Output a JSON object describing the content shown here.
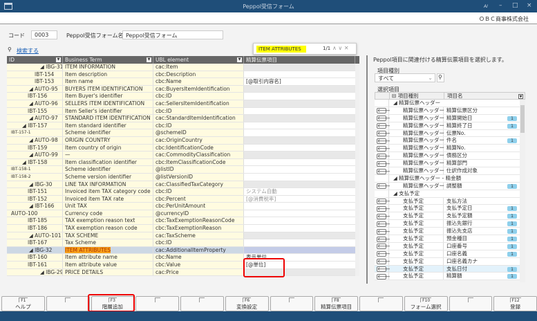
{
  "window": {
    "title": "Peppol受信フォーム",
    "company": "ＯＢＣ商事株式会社",
    "ai_label": "AI"
  },
  "form": {
    "code_label": "コード",
    "code_value": "0003",
    "name_label": "Peppol受信フォーム名",
    "name_value": "Peppol受信フォーム",
    "search_link": "検索する"
  },
  "find": {
    "query": "ITEM ATTRIBUTES",
    "count": "1/1"
  },
  "grid": {
    "headers": [
      "ID",
      "Business Term",
      "UBL element",
      "精算伝票項目"
    ],
    "rows": [
      {
        "id": "IBG-31",
        "term": "ITEM INFORMATION",
        "ubl": "cac:Item",
        "map": "",
        "group": true,
        "lvl": 0
      },
      {
        "id": "IBT-154",
        "term": "Item description",
        "ubl": "cbc:Description",
        "map": "",
        "lvl": 1
      },
      {
        "id": "IBT-153",
        "term": "Item name",
        "ubl": "cbc:Name",
        "map": "[@取引内容名]",
        "lvl": 1
      },
      {
        "id": "AUTO-95",
        "term": "BUYERS ITEM IDENTIFICATION",
        "ubl": "cac:BuyersItemIdentification",
        "map": "",
        "group": true,
        "lvl": 1
      },
      {
        "id": "IBT-156",
        "term": "Item Buyer's identifier",
        "ubl": "cbc:ID",
        "map": "",
        "lvl": 2
      },
      {
        "id": "AUTO-96",
        "term": "SELLERS ITEM IDENTIFICATION",
        "ubl": "cac:SellersItemIdentification",
        "map": "",
        "group": true,
        "lvl": 1
      },
      {
        "id": "IBT-155",
        "term": "Item Seller's identifier",
        "ubl": "cbc:ID",
        "map": "",
        "lvl": 2
      },
      {
        "id": "AUTO-97",
        "term": "STANDARD ITEM IDENTIFICATION",
        "ubl": "cac:StandardItemIdentification",
        "map": "",
        "group": true,
        "lvl": 1
      },
      {
        "id": "IBT-157",
        "term": "Item standard identifier",
        "ubl": "cbc:ID",
        "map": "",
        "lvl": 2,
        "exp": true
      },
      {
        "id": "IBT-157-1",
        "term": "Scheme identifier",
        "ubl": "@schemeID",
        "map": "",
        "lvl": 3
      },
      {
        "id": "AUTO-98",
        "term": "ORIGIN COUNTRY",
        "ubl": "cac:OriginCountry",
        "map": "",
        "group": true,
        "lvl": 1
      },
      {
        "id": "IBT-159",
        "term": "Item country of origin",
        "ubl": "cbc:IdentificationCode",
        "map": "",
        "lvl": 2
      },
      {
        "id": "AUTO-99",
        "term": "—",
        "ubl": "cac:CommodityClassification",
        "map": "",
        "group": true,
        "lvl": 1
      },
      {
        "id": "IBT-158",
        "term": "Item classification identifier",
        "ubl": "cbc:ItemClassificationCode",
        "map": "",
        "lvl": 2,
        "exp": true
      },
      {
        "id": "IBT-158-1",
        "term": "Scheme identifier",
        "ubl": "@listID",
        "map": "",
        "lvl": 3
      },
      {
        "id": "IBT-158-2",
        "term": "Scheme version identifier",
        "ubl": "@listVersionID",
        "map": "",
        "lvl": 3
      },
      {
        "id": "IBG-30",
        "term": "LINE TAX INFORMATION",
        "ubl": "cac:ClassifiedTaxCategory",
        "map": "",
        "group": true,
        "lvl": 1
      },
      {
        "id": "IBT-151",
        "term": "Invoiced item TAX category code",
        "ubl": "cbc:ID",
        "map": "システム自動",
        "lvl": 2,
        "gray": true
      },
      {
        "id": "IBT-152",
        "term": "Invoiced item TAX rate",
        "ubl": "cbc:Percent",
        "map": "[@消費税率]",
        "lvl": 2,
        "gray": true
      },
      {
        "id": "IBT-166",
        "term": "Unit TAX",
        "ubl": "cbc:PerUnitAmount",
        "map": "",
        "lvl": 1,
        "exp": true
      },
      {
        "id": "AUTO-100",
        "term": "Currency code",
        "ubl": "@currencyID",
        "map": "",
        "lvl": 3
      },
      {
        "id": "IBT-185",
        "term": "TAX exemption reason text",
        "ubl": "cbc:TaxExemptionReasonCode",
        "map": "",
        "lvl": 2
      },
      {
        "id": "IBT-186",
        "term": "TAX exemption reason code",
        "ubl": "cbc:TaxExemptionReason",
        "map": "",
        "lvl": 2
      },
      {
        "id": "AUTO-101",
        "term": "TAX SCHEME",
        "ubl": "cac:TaxScheme",
        "map": "",
        "group": true,
        "lvl": 1
      },
      {
        "id": "IBT-167",
        "term": "Tax Scheme",
        "ubl": "cbc:ID",
        "map": "",
        "lvl": 2
      },
      {
        "id": "IBG-32",
        "term": "ITEM ATTRIBUTES",
        "ubl": "cac:AdditionalItemProperty",
        "map": "",
        "group": true,
        "lvl": 1,
        "selected": true
      },
      {
        "id": "IBT-160",
        "term": "Item attribute name",
        "ubl": "cbc:Name",
        "map": "表示単位",
        "lvl": 2
      },
      {
        "id": "IBT-161",
        "term": "Item attribute value",
        "ubl": "cbc:Value",
        "map": "[@単位]",
        "lvl": 2
      },
      {
        "id": "IBG-29",
        "term": "PRICE DETAILS",
        "ubl": "cac:Price",
        "map": "",
        "group": true,
        "lvl": 0
      }
    ]
  },
  "right": {
    "description": "Peppol項目に関連付ける精算伝票項目を選択します。",
    "type_label": "項目種別",
    "type_value": "すべて",
    "list_label": "選択項目",
    "headers": [
      "項目種別",
      "項目名"
    ],
    "rows": [
      {
        "group": "精算伝票ヘッダー"
      },
      {
        "type": "精算伝票ヘッダー",
        "name": "精算伝票区分",
        "badge": ""
      },
      {
        "type": "精算伝票ヘッダー",
        "name": "精算開始日",
        "badge": "1"
      },
      {
        "type": "精算伝票ヘッダー",
        "name": "精算終了日",
        "badge": "1"
      },
      {
        "type": "精算伝票ヘッダー",
        "name": "伝票No.",
        "badge": ""
      },
      {
        "type": "精算伝票ヘッダー",
        "name": "件名",
        "badge": "1"
      },
      {
        "type": "精算伝票ヘッダー",
        "name": "精算No.",
        "badge": ""
      },
      {
        "type": "精算伝票ヘッダー",
        "name": "債務区分",
        "badge": ""
      },
      {
        "type": "精算伝票ヘッダー",
        "name": "精算部門",
        "badge": ""
      },
      {
        "type": "精算伝票ヘッダー",
        "name": "仕訳作成対象",
        "badge": ""
      },
      {
        "group": "精算伝票ヘッダー - 精金額"
      },
      {
        "type": "精算伝票ヘッダー",
        "name": "調整額",
        "badge": "1"
      },
      {
        "group": "支払予定"
      },
      {
        "type": "支払予定",
        "name": "支払方法",
        "badge": ""
      },
      {
        "type": "支払予定",
        "name": "支払予定日",
        "badge": "1"
      },
      {
        "type": "支払予定",
        "name": "支払予定額",
        "badge": "1"
      },
      {
        "type": "支払予定",
        "name": "振込先銀行",
        "badge": "1"
      },
      {
        "type": "支払予定",
        "name": "振込先支店",
        "badge": "1"
      },
      {
        "type": "支払予定",
        "name": "預金種目",
        "badge": "1"
      },
      {
        "type": "支払予定",
        "name": "口座番号",
        "badge": "1"
      },
      {
        "type": "支払予定",
        "name": "口座名義",
        "badge": "1"
      },
      {
        "type": "支払予定",
        "name": "口座名義カナ",
        "badge": ""
      },
      {
        "type": "支払予定",
        "name": "支払日付",
        "badge": "1",
        "active": true
      },
      {
        "type": "支払予定",
        "name": "精算額",
        "badge": "1"
      }
    ]
  },
  "fkeys": [
    {
      "key": "F1",
      "label": "ヘルプ"
    },
    {
      "key": "",
      "label": ""
    },
    {
      "key": "F3",
      "label": "階層追加"
    },
    {
      "key": "",
      "label": ""
    },
    {
      "key": "",
      "label": ""
    },
    {
      "key": "F6",
      "label": "変換設定"
    },
    {
      "key": "",
      "label": ""
    },
    {
      "key": "F8",
      "label": "精算伝票項目"
    },
    {
      "key": "",
      "label": ""
    },
    {
      "key": "F10",
      "label": "フォーム選択"
    },
    {
      "key": "",
      "label": ""
    },
    {
      "key": "F12",
      "label": "登録"
    }
  ]
}
